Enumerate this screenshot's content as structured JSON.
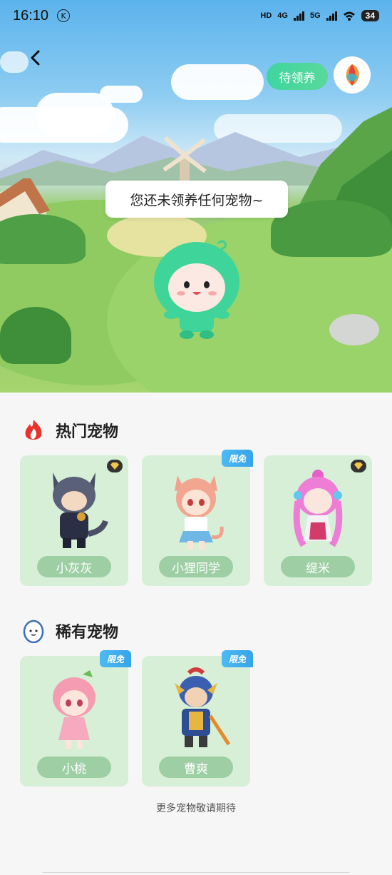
{
  "status": {
    "time": "16:10",
    "k_badge": "K",
    "hd": "HD",
    "net1": "4G",
    "net2": "5G",
    "battery": "34"
  },
  "header": {
    "adopt_label": "待领养"
  },
  "scene": {
    "bubble_text": "您还未领养任何宠物~"
  },
  "hot": {
    "title": "热门宠物",
    "pets": [
      {
        "name": "小灰灰",
        "badge": "diamond"
      },
      {
        "name": "小狸同学",
        "badge": "限免"
      },
      {
        "name": "缇米",
        "badge": "diamond"
      }
    ]
  },
  "rare": {
    "title": "稀有宠物",
    "pets": [
      {
        "name": "小桃",
        "badge": "限免"
      },
      {
        "name": "曹爽",
        "badge": "限免"
      }
    ]
  },
  "footer_note": "更多宠物敬请期待",
  "colors": {
    "accent": "#3fd5a0",
    "card_bg": "#d6efd6",
    "name_pill": "#9ecfa4",
    "tag_blue": "#37a4ea"
  }
}
